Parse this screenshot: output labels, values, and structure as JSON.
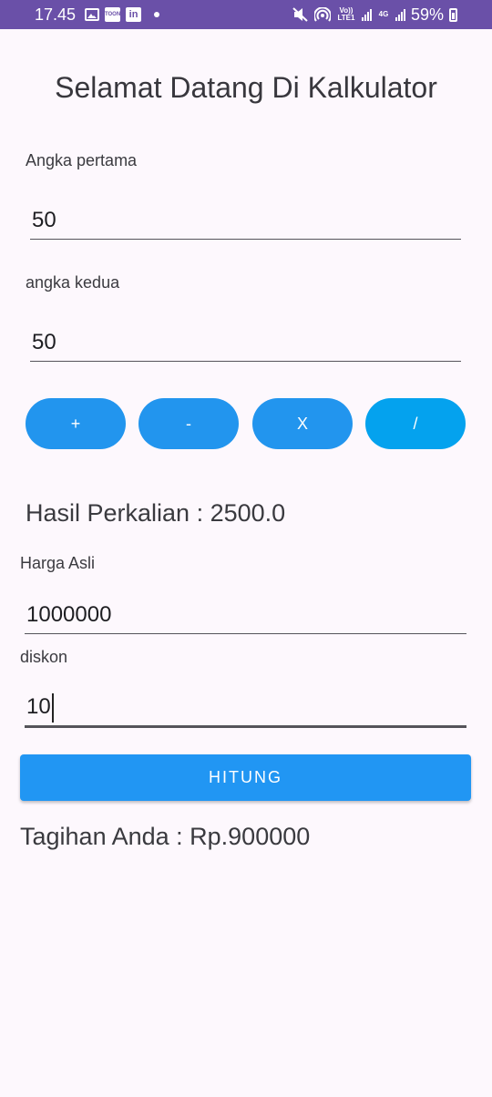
{
  "status_bar": {
    "time": "17.45",
    "app_icon_toon": "TOON",
    "app_icon_linkedin": "in",
    "volte_label": "Vo)) LTE1",
    "network_label": "4G",
    "battery": "59%"
  },
  "title": "Selamat Datang Di Kalkulator",
  "calc": {
    "first_label": "Angka pertama",
    "first_value": "50",
    "second_label": "angka kedua",
    "second_value": "50",
    "buttons": [
      "+",
      "-",
      "X",
      "/"
    ],
    "result": "Hasil Perkalian : 2500.0"
  },
  "discount": {
    "price_label": "Harga Asli",
    "price_value": "1000000",
    "discount_label": "diskon",
    "discount_value": "10",
    "button_label": "HITUNG",
    "result": "Tagihan Anda : Rp.900000"
  },
  "colors": {
    "status_bar": "#6a50a8",
    "button_blue": "#2196f3",
    "button_light_blue": "#04a2ee",
    "background": "#fdf8fd"
  }
}
